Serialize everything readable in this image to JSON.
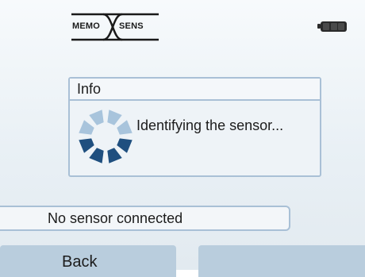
{
  "header": {
    "logo": {
      "left_text": "MEMO",
      "right_text": "SENS"
    },
    "battery_icon": "battery-full-icon"
  },
  "dialog": {
    "title": "Info",
    "message": "Identifying the sensor...",
    "spinner_icon": "loading-spinner-icon"
  },
  "status": {
    "text": "No sensor connected"
  },
  "softkeys": {
    "left_label": "Back",
    "right_label": ""
  },
  "colors": {
    "accent": "#a9c0d6",
    "softkey": "#b9cddd",
    "spinner_dark": "#1f4f7f",
    "spinner_light": "#a8c4dc"
  }
}
